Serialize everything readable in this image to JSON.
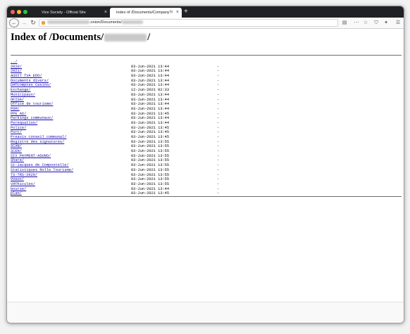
{
  "tabs": [
    {
      "title": "Vice Society - Official Site",
      "active": false
    },
    {
      "title": "Index of /Documents/Company?/",
      "active": true
    }
  ],
  "tab_close_glyph": "×",
  "new_tab_glyph": "+",
  "url": {
    "suffix": ".onion/Documents/"
  },
  "heading": {
    "prefix": "Index of /Documents/",
    "suffix": "/"
  },
  "parent_link": "../",
  "entries": [
    {
      "name": "2020/",
      "date": "03-Jun-2021 13:44",
      "size": "-"
    },
    {
      "name": "2021/",
      "date": "03-Jun-2021 13:44",
      "size": "-"
    },
    {
      "name": "AUDIT TVA EDO/",
      "date": "03-Jun-2021 13:44",
      "size": "-"
    },
    {
      "name": "Documents divers/",
      "date": "03-Jun-2021 13:44",
      "size": "-"
    },
    {
      "name": "DÃ©comptes Casino/",
      "date": "03-Jun-2021 13:44",
      "size": "-"
    },
    {
      "name": "Exchange/",
      "date": "12-Jun-2021 02:33",
      "size": "-"
    },
    {
      "name": "Municipaux/",
      "date": "03-Jun-2021 13:44",
      "size": "-"
    },
    {
      "name": "OFISA/",
      "date": "03-Jun-2021 13:44",
      "size": "-"
    },
    {
      "name": "Office de tourisme/",
      "date": "03-Jun-2021 13:44",
      "size": "-"
    },
    {
      "name": "PDM/",
      "date": "03-Jun-2021 13:44",
      "size": "-"
    },
    {
      "name": "PPE A6/",
      "date": "03-Jun-2021 13:45",
      "size": "-"
    },
    {
      "name": "Parkings communaux/",
      "date": "03-Jun-2021 13:44",
      "size": "-"
    },
    {
      "name": "Perequation/",
      "date": "03-Jun-2021 13:44",
      "size": "-"
    },
    {
      "name": "Police/",
      "date": "03-Jun-2021 13:45",
      "size": "-"
    },
    {
      "name": "Port/",
      "date": "03-Jun-2021 13:45",
      "size": "-"
    },
    {
      "name": "Preavis conseil communal/",
      "date": "03-Jun-2021 13:45",
      "size": "-"
    },
    {
      "name": "Registre des signatures/",
      "date": "03-Jun-2021 13:55",
      "size": "-"
    },
    {
      "name": "SCAN/",
      "date": "03-Jun-2021 13:55",
      "size": "-"
    },
    {
      "name": "SCEN/",
      "date": "03-Jun-2021 13:55",
      "size": "-"
    },
    {
      "name": "SIX PAYMENT-ADUNO/",
      "date": "03-Jun-2021 13:55",
      "size": "-"
    },
    {
      "name": "Share/",
      "date": "03-Jun-2021 13:55",
      "size": "-"
    },
    {
      "name": "St-Jacques de Compostelle/",
      "date": "03-Jun-2021 13:55",
      "size": "-"
    },
    {
      "name": "Statistiques Rolle Tourisme/",
      "date": "03-Jun-2021 13:55",
      "size": "-"
    },
    {
      "name": "TS-TRS-2020/",
      "date": "03-Jun-2021 13:55",
      "size": "-"
    },
    {
      "name": "Voeux/",
      "date": "03-Jun-2021 13:55",
      "size": "-"
    },
    {
      "name": "VÃ©hicules/",
      "date": "03-Jun-2021 13:55",
      "size": "-"
    },
    {
      "name": "bourse/",
      "date": "03-Jun-2021 13:44",
      "size": "-"
    },
    {
      "name": "plan/",
      "date": "03-Jun-2021 13:45",
      "size": "-"
    }
  ]
}
